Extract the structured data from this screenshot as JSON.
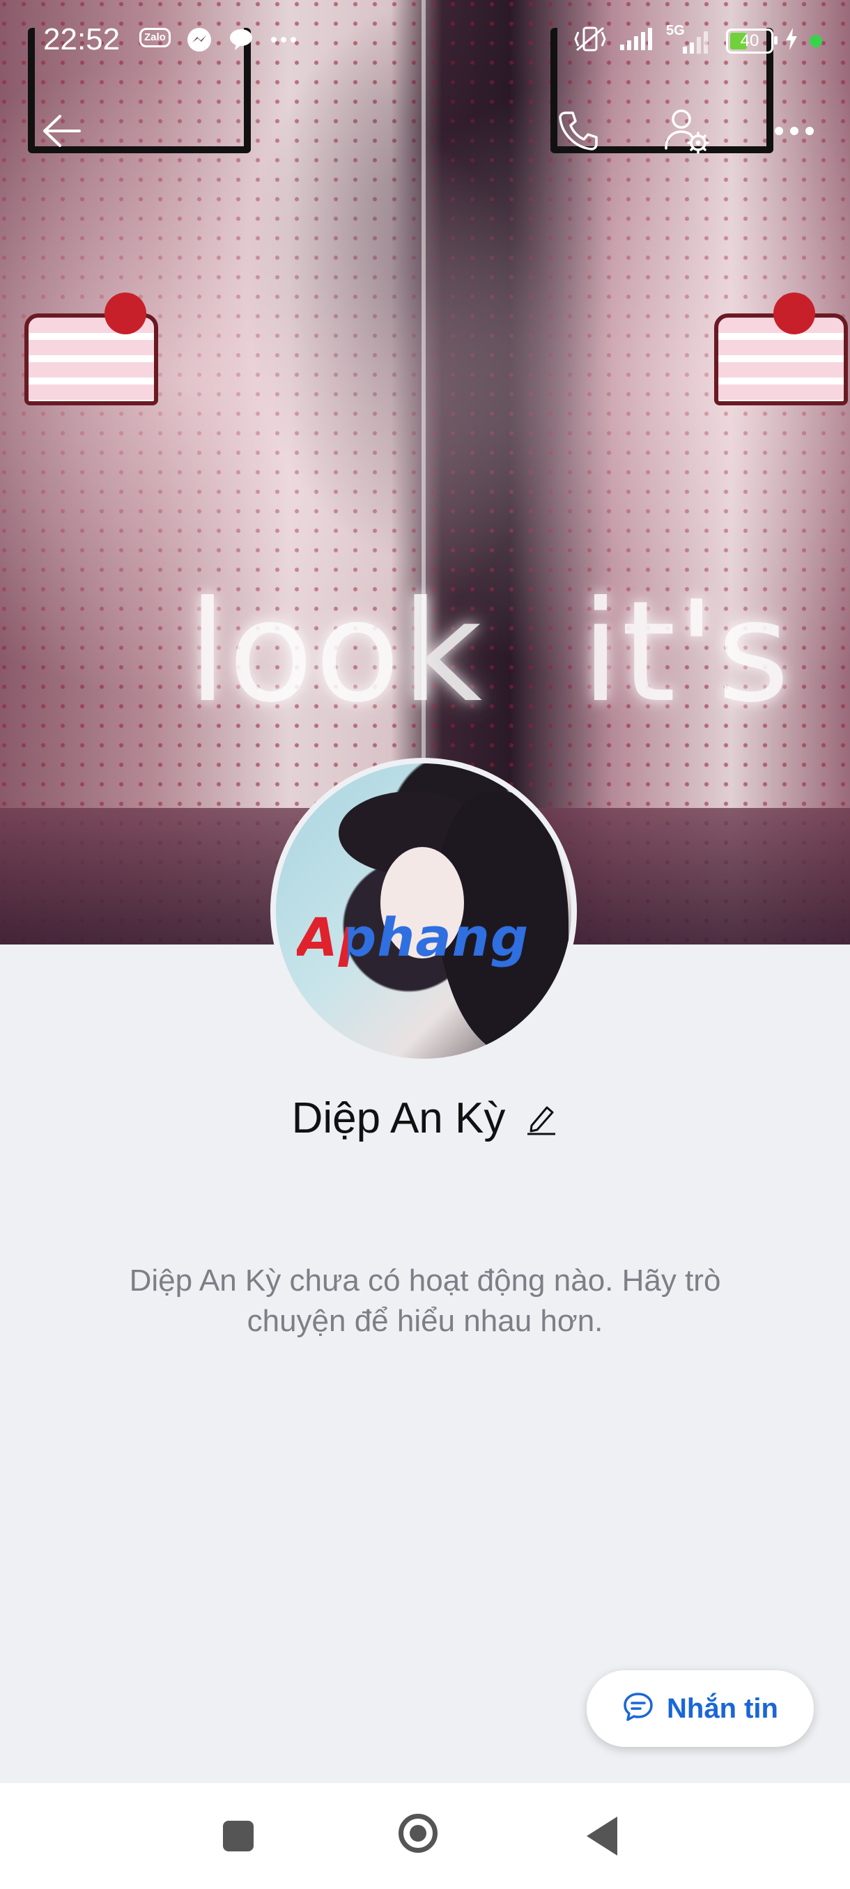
{
  "status_bar": {
    "time": "22:52",
    "notification_icons": [
      "zalo-icon",
      "messenger-icon",
      "chat-bubble-icon",
      "more-dots-icon"
    ],
    "zalo_label": "Zalo",
    "network": "5G",
    "battery_level": "40",
    "right_icons": [
      "mute-vibrate-icon",
      "signal-icon",
      "signal-5g-icon",
      "battery-icon",
      "charging-icon",
      "green-dot-icon"
    ]
  },
  "topbar": {
    "icons": [
      "back-arrow-icon",
      "phone-icon",
      "user-settings-icon",
      "more-options-icon"
    ]
  },
  "cover": {
    "overlay_text_1": "look",
    "overlay_text_2": "it's"
  },
  "avatar": {
    "watermark": "Aphang"
  },
  "profile": {
    "name": "Diệp An Kỳ",
    "empty_message": "Diệp An Kỳ chưa có hoạt động nào. Hãy trò chuyện để hiểu nhau hơn."
  },
  "actions": {
    "message_label": "Nhắn tin"
  },
  "navbar": {
    "icons": [
      "recents-square-icon",
      "home-circle-icon",
      "back-triangle-icon"
    ]
  },
  "colors": {
    "accent": "#1a66d8",
    "background": "#eef0f4",
    "name_text": "#111111",
    "muted_text": "#7b7f86"
  }
}
